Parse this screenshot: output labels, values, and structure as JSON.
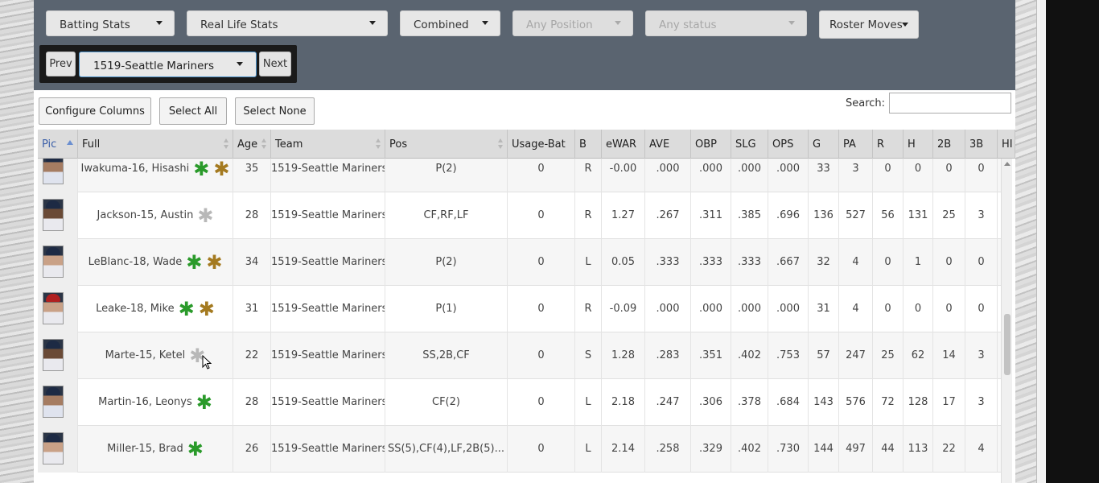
{
  "filters": {
    "stat_type": "Batting Stats",
    "stat_source": "Real Life Stats",
    "split": "Combined",
    "position": "Any Position",
    "status": "Any status",
    "roster_moves": "Roster Moves"
  },
  "team_nav": {
    "prev": "Prev",
    "team": "1519-Seattle Mariners",
    "next": "Next"
  },
  "toolbar": {
    "configure": "Configure Columns",
    "select_all": "Select All",
    "select_none": "Select None",
    "search_label": "Search:",
    "search_value": ""
  },
  "columns": [
    "Pic",
    "Full",
    "Age",
    "Team",
    "Pos",
    "Usage-Bat",
    "B",
    "eWAR",
    "AVE",
    "OBP",
    "SLG",
    "OPS",
    "G",
    "PA",
    "R",
    "H",
    "2B",
    "3B",
    "HI"
  ],
  "rows": [
    {
      "name": "Iwakuma-16, Hisashi",
      "icons": [
        "g",
        "o"
      ],
      "age": "35",
      "team": "1519-Seattle Mariners",
      "pos": "P(2)",
      "usage": "0",
      "b": "R",
      "ewar": "-0.00",
      "ave": ".000",
      "obp": ".000",
      "slg": ".000",
      "ops": ".000",
      "g": "33",
      "pa": "3",
      "r": "0",
      "h": "0",
      "d": "0",
      "t": "0",
      "pic": "mid"
    },
    {
      "name": "Jackson-15, Austin",
      "icons": [
        "gr"
      ],
      "age": "28",
      "team": "1519-Seattle Mariners",
      "pos": "CF,RF,LF",
      "usage": "0",
      "b": "R",
      "ewar": "1.27",
      "ave": ".267",
      "obp": ".311",
      "slg": ".385",
      "ops": ".696",
      "g": "136",
      "pa": "527",
      "r": "56",
      "h": "131",
      "d": "25",
      "t": "3",
      "pic": "dark"
    },
    {
      "name": "LeBlanc-18, Wade",
      "icons": [
        "g",
        "o"
      ],
      "age": "34",
      "team": "1519-Seattle Mariners",
      "pos": "P(2)",
      "usage": "0",
      "b": "L",
      "ewar": "0.05",
      "ave": ".333",
      "obp": ".333",
      "slg": ".333",
      "ops": ".667",
      "g": "32",
      "pa": "4",
      "r": "0",
      "h": "1",
      "d": "0",
      "t": "0",
      "pic": ""
    },
    {
      "name": "Leake-18, Mike",
      "icons": [
        "g",
        "o"
      ],
      "age": "31",
      "team": "1519-Seattle Mariners",
      "pos": "P(1)",
      "usage": "0",
      "b": "R",
      "ewar": "-0.09",
      "ave": ".000",
      "obp": ".000",
      "slg": ".000",
      "ops": ".000",
      "g": "31",
      "pa": "4",
      "r": "0",
      "h": "0",
      "d": "0",
      "t": "0",
      "pic": "red"
    },
    {
      "name": "Marte-15, Ketel",
      "icons": [
        "gr"
      ],
      "age": "22",
      "team": "1519-Seattle Mariners",
      "pos": "SS,2B,CF",
      "usage": "0",
      "b": "S",
      "ewar": "1.28",
      "ave": ".283",
      "obp": ".351",
      "slg": ".402",
      "ops": ".753",
      "g": "57",
      "pa": "247",
      "r": "25",
      "h": "62",
      "d": "14",
      "t": "3",
      "pic": "dark"
    },
    {
      "name": "Martin-16, Leonys",
      "icons": [
        "g"
      ],
      "age": "28",
      "team": "1519-Seattle Mariners",
      "pos": "CF(2)",
      "usage": "0",
      "b": "L",
      "ewar": "2.18",
      "ave": ".247",
      "obp": ".306",
      "slg": ".378",
      "ops": ".684",
      "g": "143",
      "pa": "576",
      "r": "72",
      "h": "128",
      "d": "17",
      "t": "3",
      "pic": "mid"
    },
    {
      "name": "Miller-15, Brad",
      "icons": [
        "g"
      ],
      "age": "26",
      "team": "1519-Seattle Mariners",
      "pos": "SS(5),CF(4),LF,2B(5)...",
      "usage": "0",
      "b": "L",
      "ewar": "2.14",
      "ave": ".258",
      "obp": ".329",
      "slg": ".402",
      "ops": ".730",
      "g": "144",
      "pa": "497",
      "r": "44",
      "h": "113",
      "d": "22",
      "t": "4",
      "pic": ""
    }
  ],
  "colors": {
    "topbar": "#5a6470",
    "active_header": "#3a5ea8",
    "green_icon": "#2a9a2a",
    "gold_icon": "#a47a20",
    "grey_icon": "#b8b8b8"
  }
}
